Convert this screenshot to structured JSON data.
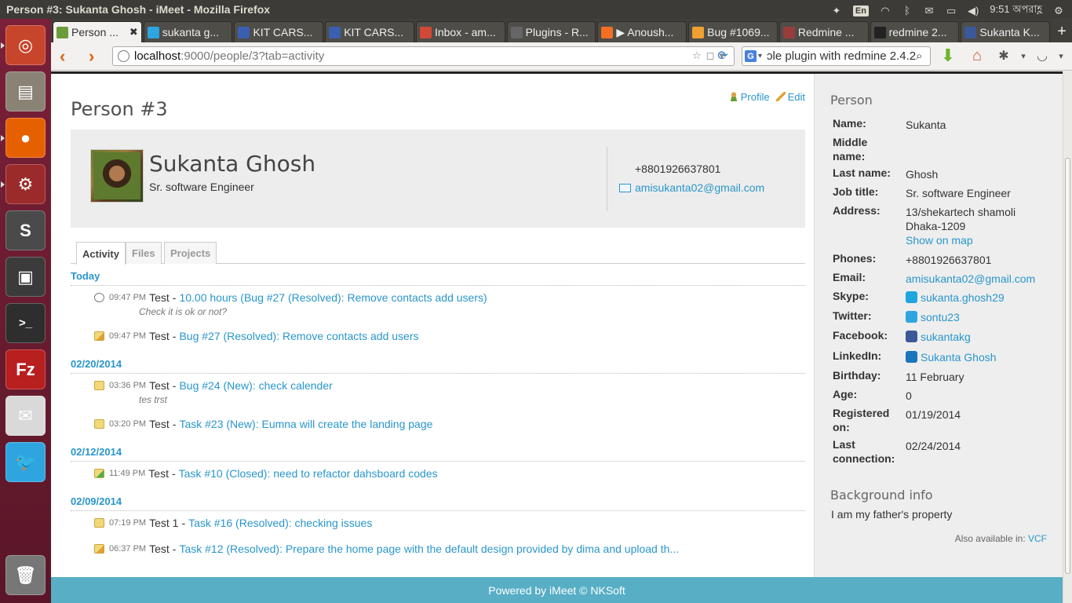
{
  "window": {
    "title": "Person #3: Sukanta Ghosh - iMeet - Mozilla Firefox",
    "indicators": {
      "keyboard": "En",
      "clock": "9:51 অপরাহ্ণ"
    }
  },
  "launcher": {
    "items": [
      {
        "name": "ubuntu-home",
        "icon": "ubuntu-icon",
        "color": "#c7452b"
      },
      {
        "name": "files",
        "icon": "file-cabinet-icon",
        "color": "#8a8275"
      },
      {
        "name": "firefox",
        "icon": "firefox-icon",
        "color": "#e66000"
      },
      {
        "name": "system-settings",
        "icon": "gear-wrench-icon",
        "color": "#9b2a2a"
      },
      {
        "name": "sublime-text",
        "icon": "sublime-icon",
        "color": "#4a4a4a"
      },
      {
        "name": "lock-screen",
        "icon": "monitor-lock-icon",
        "color": "#3b3b3b"
      },
      {
        "name": "terminal",
        "icon": "terminal-icon",
        "color": "#2e2e2e"
      },
      {
        "name": "filezilla",
        "icon": "filezilla-icon",
        "color": "#b81f1f"
      },
      {
        "name": "mail",
        "icon": "envelope-icon",
        "color": "#d9d9d9"
      },
      {
        "name": "twitter",
        "icon": "twitter-bird-icon",
        "color": "#2fa5e0"
      },
      {
        "name": "trash",
        "icon": "trash-icon",
        "color": "#777"
      }
    ]
  },
  "tabs": [
    {
      "label": "Person ...",
      "favicon": "person-icon",
      "color": "#6b9c3a",
      "active": true
    },
    {
      "label": "sukanta g...",
      "favicon": "twitter-icon",
      "color": "#2fa5e0"
    },
    {
      "label": "KIT CARS...",
      "favicon": "kit-icon",
      "color": "#3a5fb0"
    },
    {
      "label": "KIT CARS...",
      "favicon": "kit-icon",
      "color": "#3a5fb0"
    },
    {
      "label": "Inbox - am...",
      "favicon": "gmail-icon",
      "color": "#d14836"
    },
    {
      "label": "Plugins - R...",
      "favicon": "redmine-icon",
      "color": "#666"
    },
    {
      "label": "▶ Anoush...",
      "favicon": "soundcloud-icon",
      "color": "#f26f23"
    },
    {
      "label": "Bug #1069...",
      "favicon": "launchpad-icon",
      "color": "#f0a030"
    },
    {
      "label": "Redmine ...",
      "favicon": "redmine-gear-icon",
      "color": "#9a3c3c"
    },
    {
      "label": "redmine 2...",
      "favicon": "github-icon",
      "color": "#222"
    },
    {
      "label": "Sukanta K...",
      "favicon": "facebook-icon",
      "color": "#3b5998"
    }
  ],
  "navbar": {
    "url_host": "localhost",
    "url_rest": ":9000/people/3?tab=activity",
    "search_text": "ɔle plugin with redmine 2.4.2",
    "search_engine": "G"
  },
  "page": {
    "title": "Person #3",
    "actions": {
      "profile": "Profile",
      "edit": "Edit"
    },
    "person": {
      "name": "Sukanta Ghosh",
      "job_title": "Sr. software Engineer",
      "phone": "+8801926637801",
      "email": "amisukanta02@gmail.com"
    },
    "tabs": [
      "Activity",
      "Files",
      "Projects"
    ],
    "activity": [
      {
        "day": "Today",
        "entries": [
          {
            "icon": "time-entry-icon",
            "time": "09:47 PM",
            "author": "Test",
            "link": "10.00 hours (Bug #27 (Resolved): Remove contacts add users)",
            "desc": "Check it is ok or not?"
          },
          {
            "icon": "issue-edit-icon",
            "time": "09:47 PM",
            "author": "Test",
            "link": "Bug #27 (Resolved): Remove contacts add users",
            "desc": ""
          }
        ]
      },
      {
        "day": "02/20/2014",
        "entries": [
          {
            "icon": "issue-icon",
            "time": "03:36 PM",
            "author": "Test",
            "link": "Bug #24 (New): check calender",
            "desc": "tes trst"
          },
          {
            "icon": "issue-icon",
            "time": "03:20 PM",
            "author": "Test",
            "link": "Task #23 (New): Eumna will create the landing page",
            "desc": ""
          }
        ]
      },
      {
        "day": "02/12/2014",
        "entries": [
          {
            "icon": "issue-closed-icon",
            "time": "11:49 PM",
            "author": "Test",
            "link": "Task #10 (Closed): need to refactor dahsboard codes",
            "desc": ""
          }
        ]
      },
      {
        "day": "02/09/2014",
        "entries": [
          {
            "icon": "issue-icon",
            "time": "07:19 PM",
            "author": "Test 1",
            "link": "Task #16 (Resolved): checking issues",
            "desc": ""
          },
          {
            "icon": "issue-edit-icon",
            "time": "06:37 PM",
            "author": "Test",
            "link": "Task #12 (Resolved): Prepare the home page with the default design provided by dima and upload th...",
            "desc": ""
          }
        ]
      }
    ],
    "footer": "Powered by iMeet © NKSoft"
  },
  "sidebar": {
    "heading": "Person",
    "fields": [
      {
        "label": "Name:",
        "value": "Sukanta"
      },
      {
        "label": "Middle name:",
        "value": ""
      },
      {
        "label": "Last name:",
        "value": "Ghosh"
      },
      {
        "label": "Job title:",
        "value": "Sr. software Engineer"
      },
      {
        "label": "Address:",
        "value": "13/shekartech shamoli Dhaka-1209",
        "link": "Show on map"
      },
      {
        "label": "Phones:",
        "value": "+8801926637801"
      },
      {
        "label": "Email:",
        "value": "amisukanta02@gmail.com",
        "is_link": true
      },
      {
        "label": "Skype:",
        "value": "sukanta.ghosh29",
        "is_link": true,
        "icon": "skype-icon",
        "icon_color": "#1fa6e0"
      },
      {
        "label": "Twitter:",
        "value": "sontu23",
        "is_link": true,
        "icon": "twitter-icon",
        "icon_color": "#2fa5e0"
      },
      {
        "label": "Facebook:",
        "value": "sukantakg",
        "is_link": true,
        "icon": "facebook-icon",
        "icon_color": "#3b5998"
      },
      {
        "label": "LinkedIn:",
        "value": "Sukanta Ghosh",
        "is_link": true,
        "icon": "linkedin-icon",
        "icon_color": "#1b75bb"
      },
      {
        "label": "Birthday:",
        "value": "11 February"
      },
      {
        "label": "Age:",
        "value": "0"
      },
      {
        "label": "Registered on:",
        "value": "01/19/2014"
      },
      {
        "label": "Last connection:",
        "value": "02/24/2014"
      }
    ],
    "background_heading": "Background info",
    "background_text": "I am my father's property",
    "also_available_label": "Also available in:",
    "also_available_link": "VCF"
  },
  "colors": {
    "link": "#2996cc",
    "footer": "#57aec5",
    "launcher": "#6e1c33"
  }
}
